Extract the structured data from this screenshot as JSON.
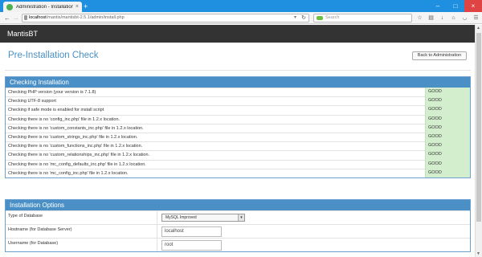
{
  "browser": {
    "tab_title": "Administration - Installation",
    "url_host": "localhost",
    "url_path": "/mantis/mantisbt-2.5.1/admin/install.php",
    "search_placeholder": "Search"
  },
  "app": {
    "brand": "MantisBT"
  },
  "page": {
    "title": "Pre-Installation Check",
    "back_button": "Back to Administration"
  },
  "checking": {
    "heading": "Checking Installation",
    "rows": [
      {
        "label": "Checking PHP version (your version is 7.1.8)",
        "status": "GOOD"
      },
      {
        "label": "Checking UTF-8 support",
        "status": "GOOD"
      },
      {
        "label": "Checking if safe mode is enabled for install script",
        "status": "GOOD"
      },
      {
        "label": "Checking there is no 'config_inc.php' file in 1.2.x location.",
        "status": "GOOD"
      },
      {
        "label": "Checking there is no 'custom_constants_inc.php' file in 1.2.x location.",
        "status": "GOOD"
      },
      {
        "label": "Checking there is no 'custom_strings_inc.php' file in 1.2.x location.",
        "status": "GOOD"
      },
      {
        "label": "Checking there is no 'custom_functions_inc.php' file in 1.2.x location.",
        "status": "GOOD"
      },
      {
        "label": "Checking there is no 'custom_relationships_inc.php' file in 1.2.x location.",
        "status": "GOOD"
      },
      {
        "label": "Checking there is no 'mc_config_defaults_inc.php' file in 1.2.x location.",
        "status": "GOOD"
      },
      {
        "label": "Checking there is no 'mc_config_inc.php' file in 1.2.x location.",
        "status": "GOOD"
      }
    ],
    "status_color": "#d3eecd"
  },
  "options": {
    "heading": "Installation Options",
    "db_type_label": "Type of Database",
    "db_type_value": "MySQL Improved",
    "hostname_label": "Hostname (for Database Server)",
    "hostname_value": "localhost",
    "username_label": "Username (for Database)",
    "username_value": "root"
  },
  "colors": {
    "accent": "#4a90c6",
    "header": "#333333",
    "tabbar": "#1f8fe0"
  }
}
